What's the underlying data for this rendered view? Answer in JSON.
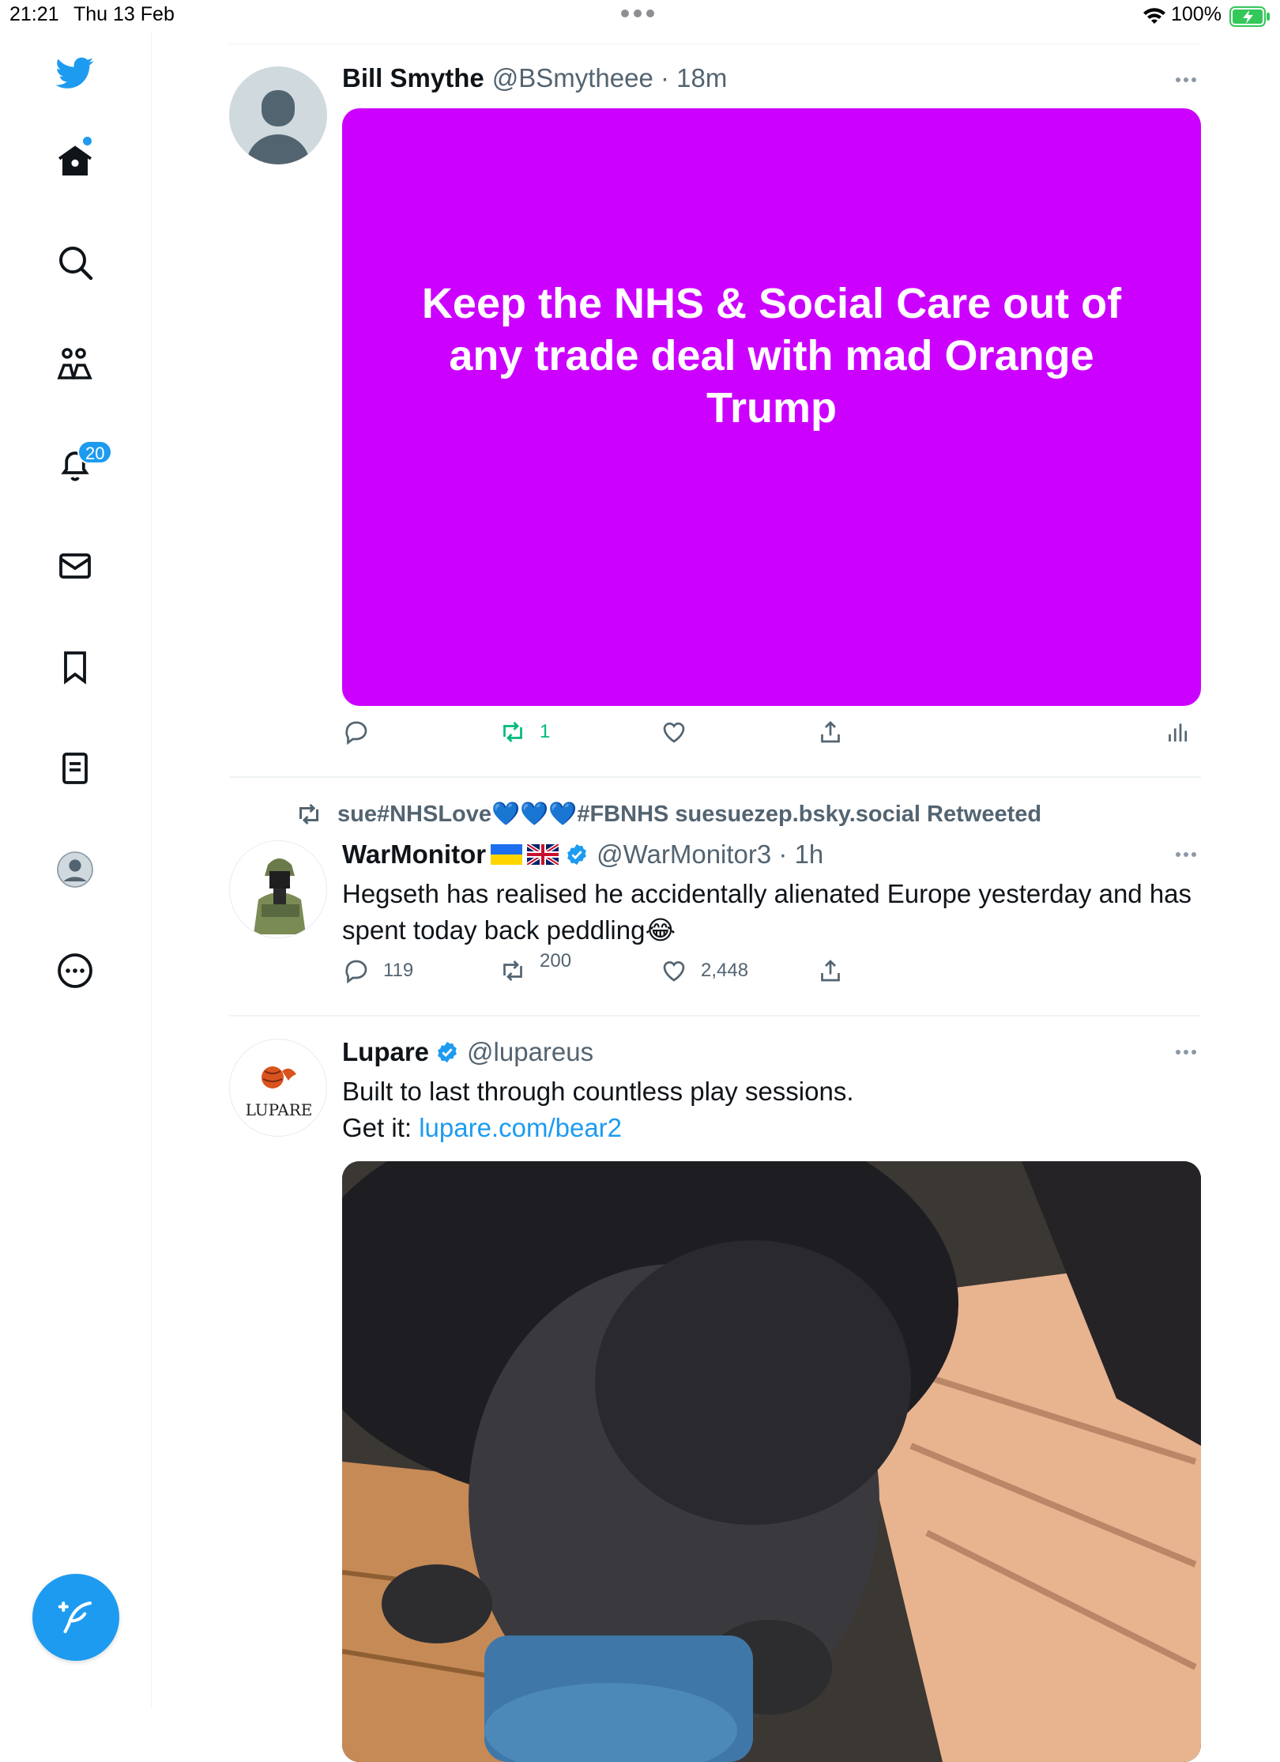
{
  "status_bar": {
    "time": "21:21",
    "date": "Thu 13 Feb",
    "battery": "100%"
  },
  "sidebar": {
    "items": [
      {
        "name": "twitter-logo",
        "icon": "bird-icon"
      },
      {
        "name": "home",
        "icon": "home-icon"
      },
      {
        "name": "explore",
        "icon": "search-icon"
      },
      {
        "name": "communities",
        "icon": "people-icon"
      },
      {
        "name": "notifications",
        "icon": "bell-icon",
        "badge": "20"
      },
      {
        "name": "messages",
        "icon": "mail-icon"
      },
      {
        "name": "bookmarks",
        "icon": "bookmark-icon"
      },
      {
        "name": "lists",
        "icon": "list-icon"
      },
      {
        "name": "profile",
        "icon": "avatar-icon"
      },
      {
        "name": "more",
        "icon": "more-circle-icon"
      }
    ],
    "notifications_badge": "20",
    "compose_icon": "compose-quill-icon"
  },
  "tweets": [
    {
      "author": "Bill Smythe",
      "handle": "@BSmytheee · 18m",
      "card_text": "Keep the NHS & Social Care out of any trade deal with mad Orange Trump",
      "card_color": "#cc00ff",
      "retweets": "1"
    },
    {
      "retweeted_by": "sue#NHSLove💙💙💙#FBNHS suesuezep.bsky.social Retweeted",
      "author": "WarMonitor",
      "flags": "🇺🇦 🇬🇧",
      "handle": "@WarMonitor3 · 1h",
      "text": "Hegseth has realised he accidentally alienated Europe yesterday and has spent today back peddling😂",
      "replies": "119",
      "retweets": "200",
      "likes": "2,448"
    },
    {
      "author": "Lupare",
      "handle": "@lupareus",
      "avatar_text": "LUPARE",
      "text_line1": "Built to last through countless play sessions.",
      "text_prefix": "Get it: ",
      "link": "lupare.com/bear2"
    }
  ],
  "colors": {
    "accent": "#1d9bf0",
    "retweet_green": "#00ba7c",
    "card_purple": "#cc00ff"
  }
}
